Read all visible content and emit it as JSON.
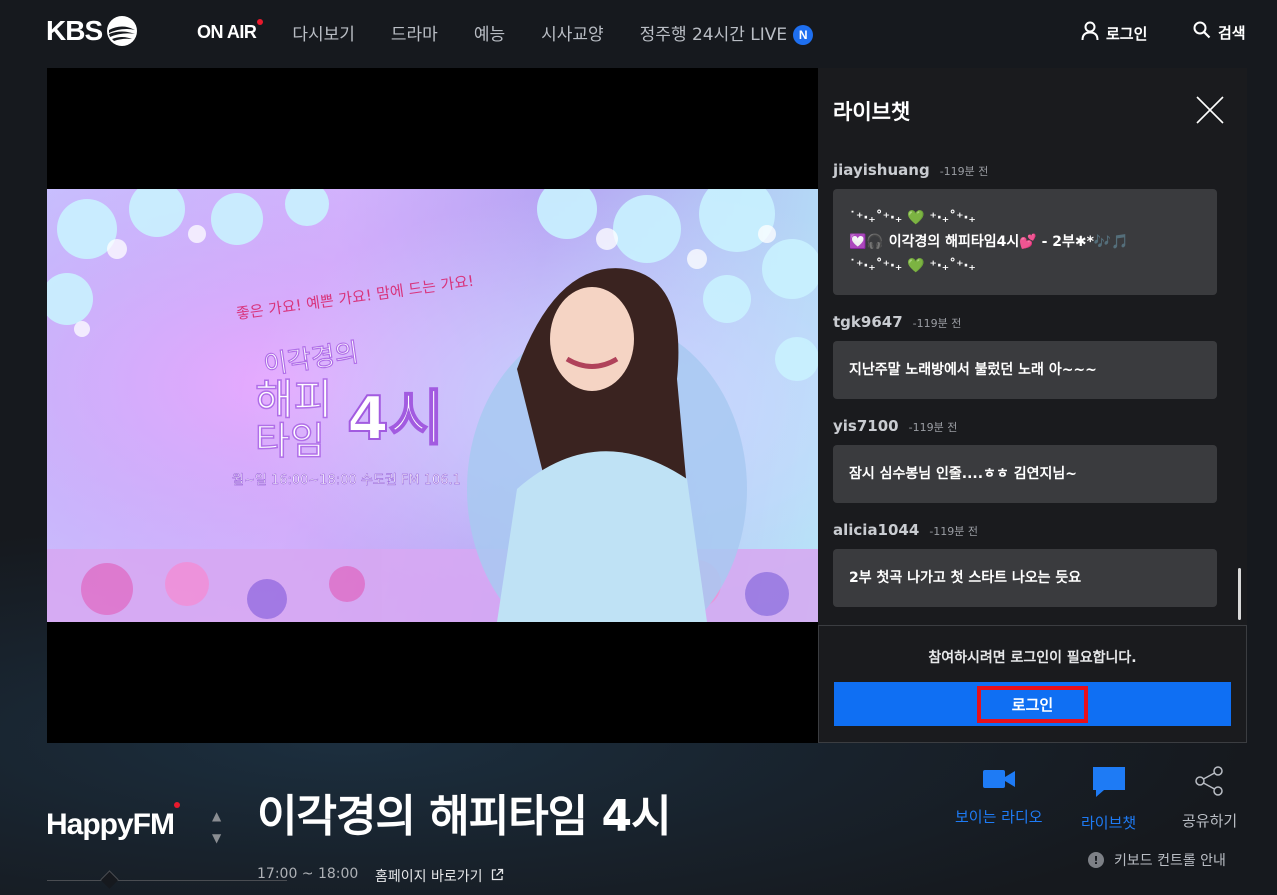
{
  "header": {
    "logo_text": "KBS",
    "nav": [
      {
        "label": "ON AIR",
        "active": true,
        "live_dot": true
      },
      {
        "label": "다시보기"
      },
      {
        "label": "드라마"
      },
      {
        "label": "예능"
      },
      {
        "label": "시사교양"
      },
      {
        "label": "정주행 24시간 LIVE",
        "badge": "N"
      }
    ],
    "login_label": "로그인",
    "search_label": "검색"
  },
  "player": {
    "poster": {
      "tagline": "좋은 가요! 예쁜 가요! 맘에 드는 가요!",
      "show_title_line1": "이각경의",
      "show_title_line2": "해피",
      "show_title_line3": "타임",
      "show_title_number": "4시",
      "schedule": "월~일 16:00~18:00 수도권 FM 106.1"
    }
  },
  "chat": {
    "title": "라이브챗",
    "messages": [
      {
        "user": "jiayishuang",
        "time": "-119분 전",
        "lines": [
          "˙⁺‧₊˚⁺‧₊ 💚 ⁺‧₊˚⁺‧₊",
          "💟🎧 이각경의 해피타임4시💕 - 2부✱*🎶🎵",
          "˙⁺‧₊˚⁺‧₊ 💚 ⁺‧₊˚⁺‧₊"
        ]
      },
      {
        "user": "tgk9647",
        "time": "-119분 전",
        "lines": [
          "지난주말 노래방에서 불렀던 노래 아~~~"
        ]
      },
      {
        "user": "yis7100",
        "time": "-119분 전",
        "lines": [
          "잠시 심수봉님 인줄....ㅎㅎ 김연지님~"
        ]
      },
      {
        "user": "alicia1044",
        "time": "-119분 전",
        "lines": [
          "2부 첫곡 나가고 첫 스타트 나오는 듯요"
        ]
      }
    ],
    "login_notice": "참여하시려면 로그인이 필요합니다.",
    "login_button": "로그인"
  },
  "program": {
    "channel": "HappyFM",
    "title": "이각경의 해피타임 4시",
    "time": "17:00 ~ 18:00",
    "homepage_link": "홈페이지 바로가기"
  },
  "actions": {
    "video_radio": "보이는 라디오",
    "live_chat": "라이브챗",
    "share": "공유하기",
    "keyboard_guide": "키보드 컨트롤 안내"
  },
  "colors": {
    "accent_blue": "#0f6ff3",
    "live_red": "#e8192c",
    "highlight_box": "#e8101b"
  }
}
